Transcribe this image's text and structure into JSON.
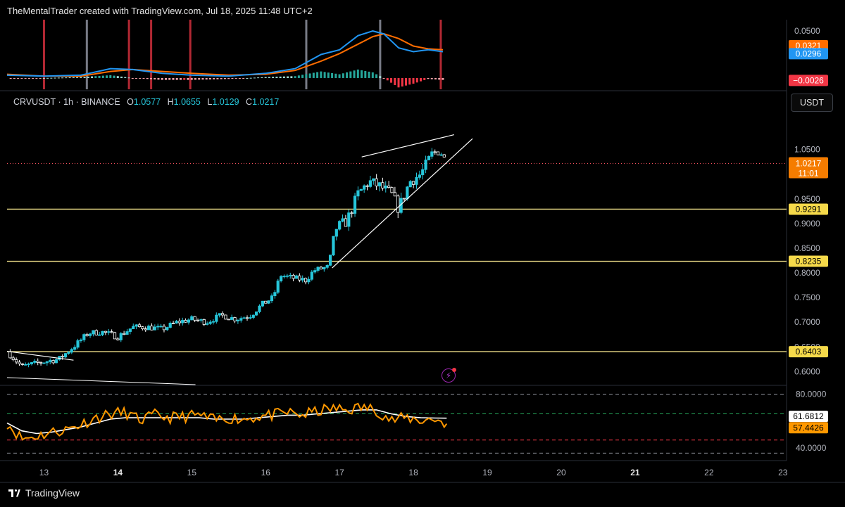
{
  "header": {
    "credit": "TheMentalTrader created with TradingView.com, Jul 18, 2025 11:48 UTC+2"
  },
  "symbol": {
    "name": "CRVUSDT",
    "interval": "1h",
    "exchange": "BINANCE",
    "o_label": "O",
    "o": "1.0577",
    "h_label": "H",
    "h": "1.0655",
    "l_label": "L",
    "l": "1.0129",
    "c_label": "C",
    "c": "1.0217"
  },
  "currency_button": "USDT",
  "footer": {
    "brand": "TradingView"
  },
  "colors": {
    "up": "#26c6da",
    "down": "#ffffff",
    "level": "#f0e08a",
    "macd": "#2196f3",
    "signal": "#ff6d00",
    "rsi": "#ff9800",
    "rsi_ma": "#ffffff",
    "vline_red": "#b22833",
    "vline_gray": "#787b86"
  },
  "chart_data": [
    {
      "type": "line",
      "panel": "macd",
      "y_tick": "0.0500",
      "ylim": [
        -0.012,
        0.062
      ],
      "series": [],
      "value_labels": [
        {
          "value": 0.0321,
          "text": "0.0321",
          "color": "#ff6d00"
        },
        {
          "value": 0.0296,
          "text": "0.0296",
          "color": "#2196f3"
        },
        {
          "value": -0.0026,
          "text": "−0.0026",
          "color": "#f23645"
        }
      ],
      "vlines": [
        {
          "x": 13.0,
          "color": "red"
        },
        {
          "x": 13.58,
          "color": "gray"
        },
        {
          "x": 14.15,
          "color": "red"
        },
        {
          "x": 14.45,
          "color": "red"
        },
        {
          "x": 14.98,
          "color": "red"
        },
        {
          "x": 16.55,
          "color": "gray"
        },
        {
          "x": 17.55,
          "color": "gray"
        },
        {
          "x": 18.37,
          "color": "red"
        }
      ],
      "macd_points": [
        [
          12.5,
          0.003
        ],
        [
          13.0,
          0.002
        ],
        [
          13.5,
          0.003
        ],
        [
          13.9,
          0.01
        ],
        [
          14.2,
          0.009
        ],
        [
          14.6,
          0.005
        ],
        [
          15.0,
          0.003
        ],
        [
          15.5,
          0.002
        ],
        [
          16.0,
          0.005
        ],
        [
          16.4,
          0.01
        ],
        [
          16.75,
          0.025
        ],
        [
          17.0,
          0.03
        ],
        [
          17.25,
          0.045
        ],
        [
          17.45,
          0.05
        ],
        [
          17.6,
          0.047
        ],
        [
          17.8,
          0.032
        ],
        [
          18.0,
          0.028
        ],
        [
          18.2,
          0.03
        ],
        [
          18.4,
          0.028
        ]
      ],
      "signal_points": [
        [
          12.5,
          0.004
        ],
        [
          13.0,
          0.002
        ],
        [
          13.5,
          0.002
        ],
        [
          13.9,
          0.007
        ],
        [
          14.2,
          0.009
        ],
        [
          14.6,
          0.007
        ],
        [
          15.0,
          0.005
        ],
        [
          15.5,
          0.003
        ],
        [
          16.0,
          0.004
        ],
        [
          16.4,
          0.008
        ],
        [
          16.75,
          0.018
        ],
        [
          17.0,
          0.026
        ],
        [
          17.25,
          0.036
        ],
        [
          17.45,
          0.044
        ],
        [
          17.6,
          0.047
        ],
        [
          17.8,
          0.042
        ],
        [
          18.0,
          0.034
        ],
        [
          18.2,
          0.031
        ],
        [
          18.4,
          0.03
        ]
      ]
    },
    {
      "type": "candlestick",
      "panel": "price",
      "x_ticks": [
        "13",
        "14",
        "15",
        "16",
        "17",
        "18",
        "19",
        "20",
        "21",
        "22",
        "23"
      ],
      "bold_ticks": [
        "14",
        "21"
      ],
      "y_ticks": [
        "1.0500",
        "0.9500",
        "0.9000",
        "0.8500",
        "0.8000",
        "0.7500",
        "0.7000",
        "0.6500",
        "0.6000"
      ],
      "ylim": [
        0.572,
        1.125
      ],
      "levels": [
        {
          "value": 0.9291,
          "text": "0.9291"
        },
        {
          "value": 0.8235,
          "text": "0.8235"
        },
        {
          "value": 0.6403,
          "text": "0.6403"
        }
      ],
      "last_price": {
        "value": 1.0217,
        "text": "1.0217",
        "countdown": "11:01"
      },
      "anchors": [
        [
          12.5,
          0.64
        ],
        [
          12.7,
          0.61
        ],
        [
          12.9,
          0.617
        ],
        [
          13.2,
          0.625
        ],
        [
          13.4,
          0.65
        ],
        [
          13.6,
          0.678
        ],
        [
          13.8,
          0.68
        ],
        [
          14.0,
          0.67
        ],
        [
          14.2,
          0.69
        ],
        [
          14.4,
          0.69
        ],
        [
          14.6,
          0.686
        ],
        [
          14.8,
          0.7
        ],
        [
          15.0,
          0.706
        ],
        [
          15.2,
          0.7
        ],
        [
          15.4,
          0.714
        ],
        [
          15.6,
          0.706
        ],
        [
          15.8,
          0.714
        ],
        [
          15.95,
          0.736
        ],
        [
          16.1,
          0.75
        ],
        [
          16.2,
          0.795
        ],
        [
          16.35,
          0.79
        ],
        [
          16.55,
          0.785
        ],
        [
          16.65,
          0.805
        ],
        [
          16.85,
          0.812
        ],
        [
          16.95,
          0.89
        ],
        [
          17.1,
          0.905
        ],
        [
          17.25,
          0.96
        ],
        [
          17.4,
          0.985
        ],
        [
          17.55,
          0.975
        ],
        [
          17.7,
          0.96
        ],
        [
          17.8,
          0.93
        ],
        [
          17.95,
          0.985
        ],
        [
          18.1,
          1.0
        ],
        [
          18.25,
          1.04
        ],
        [
          18.35,
          1.05
        ],
        [
          18.45,
          1.022
        ]
      ],
      "trendlines": [
        {
          "from": [
            16.9,
            0.81
          ],
          "to": [
            18.8,
            1.072
          ]
        },
        {
          "from": [
            17.3,
            1.035
          ],
          "to": [
            18.55,
            1.08
          ]
        },
        {
          "from": [
            12.5,
            0.641
          ],
          "to": [
            13.4,
            0.623
          ]
        }
      ]
    },
    {
      "type": "line",
      "panel": "rsi",
      "y_ticks": [
        "80.0000"
      ],
      "y_ticks_2": [
        "40.0000"
      ],
      "ylim": [
        32,
        83
      ],
      "bands": [
        80,
        65,
        45,
        35
      ],
      "value_labels": [
        {
          "value": 61.6812,
          "text": "61.6812",
          "color": "#ffffff"
        },
        {
          "value": 57.4426,
          "text": "57.4426",
          "color": "#ff9800"
        }
      ],
      "rsi_points": [
        [
          12.5,
          58
        ],
        [
          12.7,
          46
        ],
        [
          12.9,
          48
        ],
        [
          13.1,
          51
        ],
        [
          13.3,
          53
        ],
        [
          13.5,
          57
        ],
        [
          13.7,
          62
        ],
        [
          13.9,
          65
        ],
        [
          14.1,
          66
        ],
        [
          14.3,
          60
        ],
        [
          14.5,
          64
        ],
        [
          14.7,
          62
        ],
        [
          14.9,
          63
        ],
        [
          15.1,
          64
        ],
        [
          15.3,
          60
        ],
        [
          15.5,
          62
        ],
        [
          15.7,
          61
        ],
        [
          15.9,
          63
        ],
        [
          16.1,
          64
        ],
        [
          16.3,
          66
        ],
        [
          16.5,
          64
        ],
        [
          16.7,
          67
        ],
        [
          16.9,
          69
        ],
        [
          17.1,
          68
        ],
        [
          17.3,
          70
        ],
        [
          17.5,
          68
        ],
        [
          17.7,
          60
        ],
        [
          17.9,
          62
        ],
        [
          18.1,
          60
        ],
        [
          18.3,
          61
        ],
        [
          18.45,
          57.4426
        ]
      ],
      "rsi_ma_points": [
        [
          12.5,
          58
        ],
        [
          12.7,
          52
        ],
        [
          12.9,
          50
        ],
        [
          13.1,
          51
        ],
        [
          13.3,
          53
        ],
        [
          13.5,
          55
        ],
        [
          13.7,
          58
        ],
        [
          13.9,
          61
        ],
        [
          14.1,
          62
        ],
        [
          14.3,
          62
        ],
        [
          14.5,
          62
        ],
        [
          14.7,
          62
        ],
        [
          14.9,
          62
        ],
        [
          15.1,
          62
        ],
        [
          15.3,
          61
        ],
        [
          15.5,
          61
        ],
        [
          15.7,
          61
        ],
        [
          15.9,
          62
        ],
        [
          16.1,
          63
        ],
        [
          16.3,
          64
        ],
        [
          16.5,
          64
        ],
        [
          16.7,
          65
        ],
        [
          16.9,
          66
        ],
        [
          17.1,
          67
        ],
        [
          17.3,
          68
        ],
        [
          17.5,
          68
        ],
        [
          17.7,
          65
        ],
        [
          17.9,
          63
        ],
        [
          18.1,
          62
        ],
        [
          18.3,
          61.8
        ],
        [
          18.45,
          61.6812
        ]
      ]
    }
  ]
}
